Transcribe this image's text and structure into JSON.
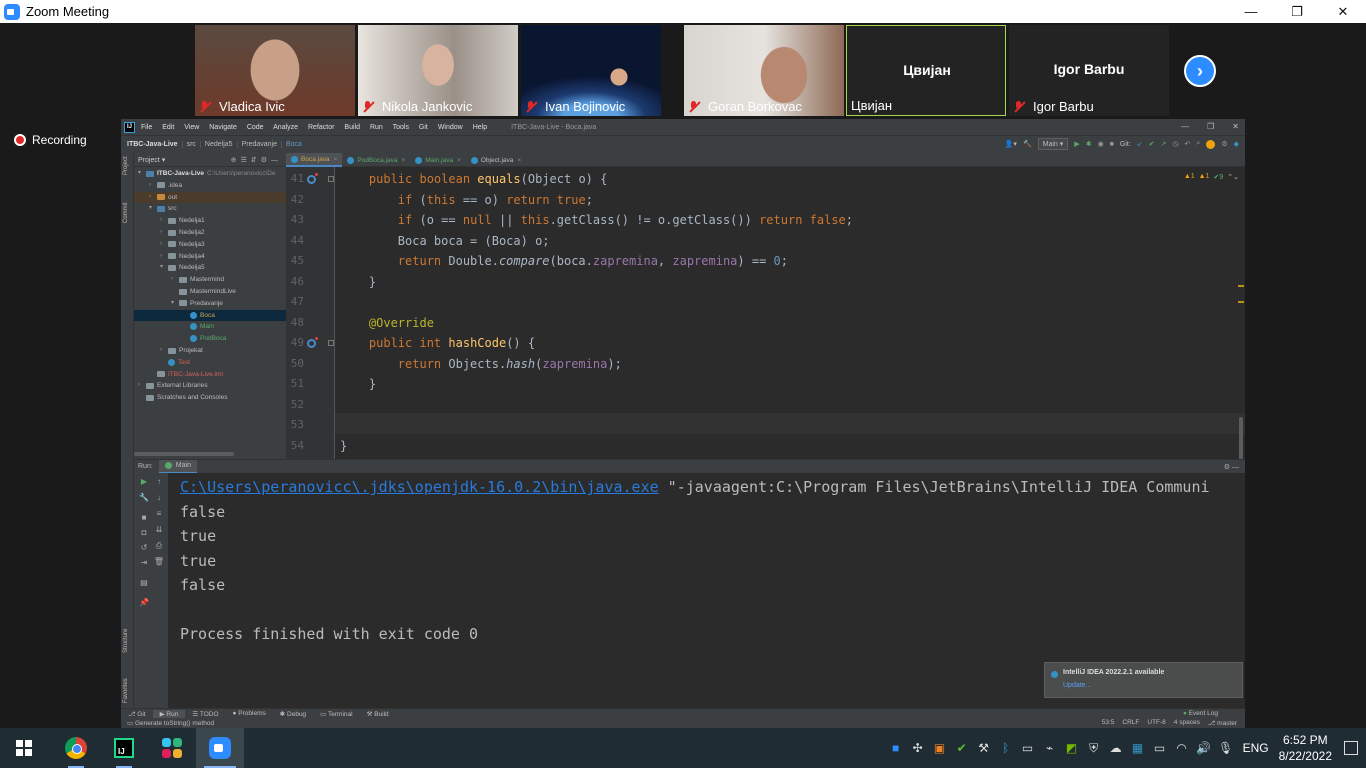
{
  "zoom": {
    "window_title": "Zoom Meeting",
    "window_buttons": [
      "—",
      "❐",
      "✕"
    ],
    "participants": [
      {
        "name": "Vladica Ivic",
        "muted": true,
        "video": true,
        "bg": "#8a7565"
      },
      {
        "name": "Nikola Jankovic",
        "muted": true,
        "video": true,
        "bg": "#b8b2aa"
      },
      {
        "name": "Ivan Bojinovic",
        "muted": true,
        "video": true,
        "bg": "#1c2f52"
      },
      {
        "name": "Goran Borkovac",
        "muted": true,
        "video": true,
        "bg": "#c8bfb6"
      },
      {
        "name": "Цвијан",
        "muted": false,
        "video": false,
        "big_name": "Цвијан"
      },
      {
        "name": "Igor Barbu",
        "muted": true,
        "video": false,
        "big_name": "Igor Barbu"
      }
    ],
    "recording_label": "Recording",
    "next_arrow": "›"
  },
  "ide": {
    "logo": "IJ",
    "menu": [
      "File",
      "Edit",
      "View",
      "Navigate",
      "Code",
      "Analyze",
      "Refactor",
      "Build",
      "Run",
      "Tools",
      "Git",
      "Window",
      "Help"
    ],
    "title": "ITBC-Java-Live - Boca.java",
    "window_buttons": [
      "—",
      "❐",
      "✕"
    ],
    "breadcrumbs": [
      "ITBC-Java-Live",
      "src",
      "Nedelja5",
      "Predavanje",
      "Boca"
    ],
    "run_config": "Main ▾",
    "git_label": "Git:",
    "project_panel": {
      "title": "Project ▾",
      "tree": [
        {
          "label": "ITBC-Java-Live",
          "path": "C:\\Users\\peranovicc\\De",
          "indent": 0,
          "arrow": "▾",
          "icon": "folder-blue",
          "bold": true
        },
        {
          "label": ".idea",
          "indent": 1,
          "arrow": "›",
          "icon": "folder"
        },
        {
          "label": "out",
          "indent": 1,
          "arrow": "›",
          "icon": "folder-orange",
          "hl": true
        },
        {
          "label": "src",
          "indent": 1,
          "arrow": "▾",
          "icon": "folder-blue"
        },
        {
          "label": "Nedelja1",
          "indent": 2,
          "arrow": "›",
          "icon": "folder"
        },
        {
          "label": "Nedelja2",
          "indent": 2,
          "arrow": "›",
          "icon": "folder"
        },
        {
          "label": "Nedelja3",
          "indent": 2,
          "arrow": "›",
          "icon": "folder"
        },
        {
          "label": "Nedelja4",
          "indent": 2,
          "arrow": "›",
          "icon": "folder"
        },
        {
          "label": "Nedelja5",
          "indent": 2,
          "arrow": "▾",
          "icon": "folder"
        },
        {
          "label": "Mastermind",
          "indent": 3,
          "arrow": "›",
          "icon": "folder"
        },
        {
          "label": "MastermindLive",
          "indent": 3,
          "arrow": "",
          "icon": "folder"
        },
        {
          "label": "Predavanje",
          "indent": 3,
          "arrow": "▾",
          "icon": "folder"
        },
        {
          "label": "Boca",
          "indent": 4,
          "arrow": "",
          "icon": "class",
          "selected": true,
          "color": "#d3a34d"
        },
        {
          "label": "Main",
          "indent": 4,
          "arrow": "",
          "icon": "class",
          "color": "#59a869"
        },
        {
          "label": "PodBoca",
          "indent": 4,
          "arrow": "",
          "icon": "class",
          "color": "#59a869"
        },
        {
          "label": "Projekat",
          "indent": 2,
          "arrow": "›",
          "icon": "folder"
        },
        {
          "label": "Test",
          "indent": 2,
          "arrow": "",
          "icon": "class",
          "color": "#d3625a"
        },
        {
          "label": "ITBC-Java-Live.iml",
          "indent": 1,
          "arrow": "",
          "icon": "file",
          "color": "#d3625a"
        },
        {
          "label": "External Libraries",
          "indent": 0,
          "arrow": "›",
          "icon": "lib"
        },
        {
          "label": "Scratches and Consoles",
          "indent": 0,
          "arrow": "",
          "icon": "scratch"
        }
      ]
    },
    "tabs": [
      {
        "label": "Boca.java",
        "active": true,
        "color": "boca"
      },
      {
        "label": "PodBoca.java",
        "active": false,
        "color": "pod"
      },
      {
        "label": "Main.java",
        "active": false,
        "color": "main"
      },
      {
        "label": "Object.java",
        "active": false,
        "color": "obj"
      }
    ],
    "inspections": {
      "warn": "▲1",
      "weak": "▲1",
      "ok": "✔9"
    },
    "code_lines": [
      41,
      42,
      43,
      44,
      45,
      46,
      47,
      48,
      49,
      50,
      51,
      52,
      53,
      54
    ],
    "run_panel": {
      "label": "Run:",
      "tab": "Main",
      "console": {
        "cmd_link": "C:\\Users\\peranovicc\\.jdks\\openjdk-16.0.2\\bin\\java.exe",
        "cmd_rest": " \"-javaagent:C:\\Program Files\\JetBrains\\IntelliJ IDEA Communi",
        "lines": [
          "false",
          "true",
          "true",
          "false",
          "",
          "Process finished with exit code 0"
        ]
      }
    },
    "notification": {
      "title": "IntelliJ IDEA 2022.2.1 available",
      "link": "Update..."
    },
    "bottom_tabs": [
      "Git",
      "Run",
      "TODO",
      "Problems",
      "Debug",
      "Terminal",
      "Build"
    ],
    "event_log": "Event Log",
    "status_message": "Generate toString() method",
    "status_right": [
      "53:5",
      "CRLF",
      "UTF-8",
      "4 spaces",
      "master"
    ],
    "side_labels": [
      "Project",
      "Commit",
      "Structure",
      "Favorites"
    ]
  },
  "taskbar": {
    "lang": "ENG",
    "time": "6:52 PM",
    "date": "8/22/2022",
    "apps": [
      "windows-start",
      "chrome",
      "intellij",
      "slack",
      "zoom"
    ]
  }
}
